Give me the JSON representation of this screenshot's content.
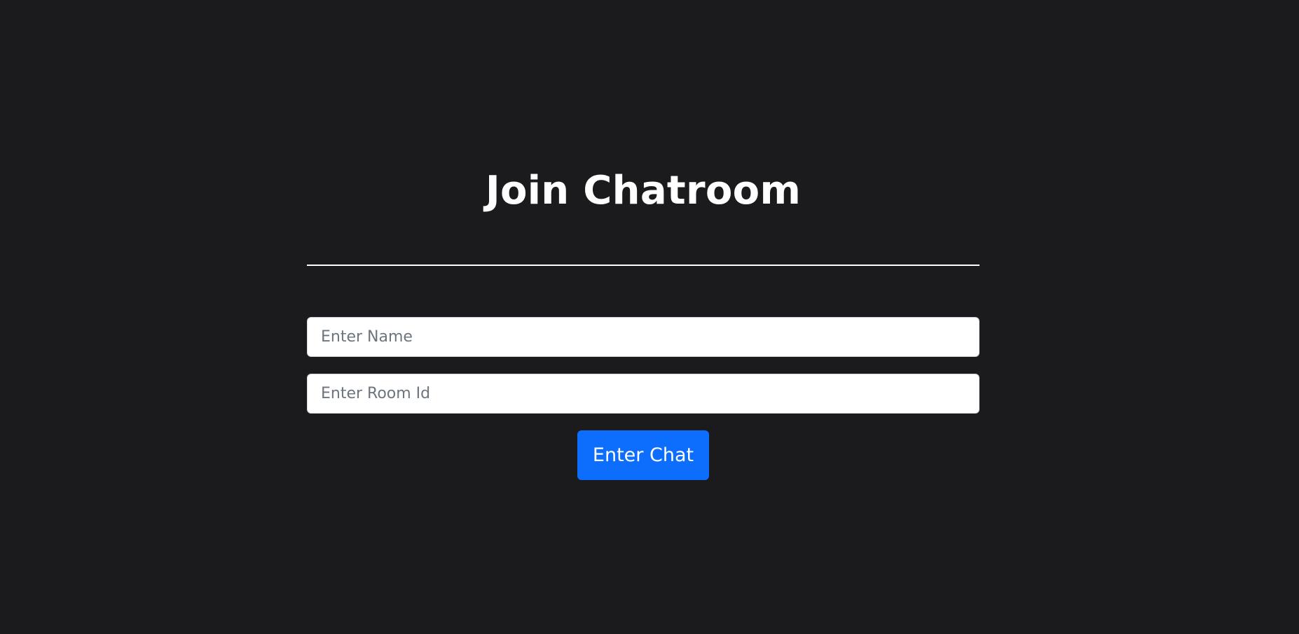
{
  "join_form": {
    "title": "Join Chatroom",
    "name_field": {
      "value": "",
      "placeholder": "Enter Name"
    },
    "room_field": {
      "value": "",
      "placeholder": "Enter Room Id"
    },
    "submit_label": "Enter Chat"
  },
  "colors": {
    "background": "#1b1b1e",
    "title_text": "#ffffff",
    "divider": "#ffffff",
    "input_background": "#ffffff",
    "placeholder_text": "#6c757d",
    "primary_button": "#0d6efd",
    "button_text": "#ffffff"
  }
}
